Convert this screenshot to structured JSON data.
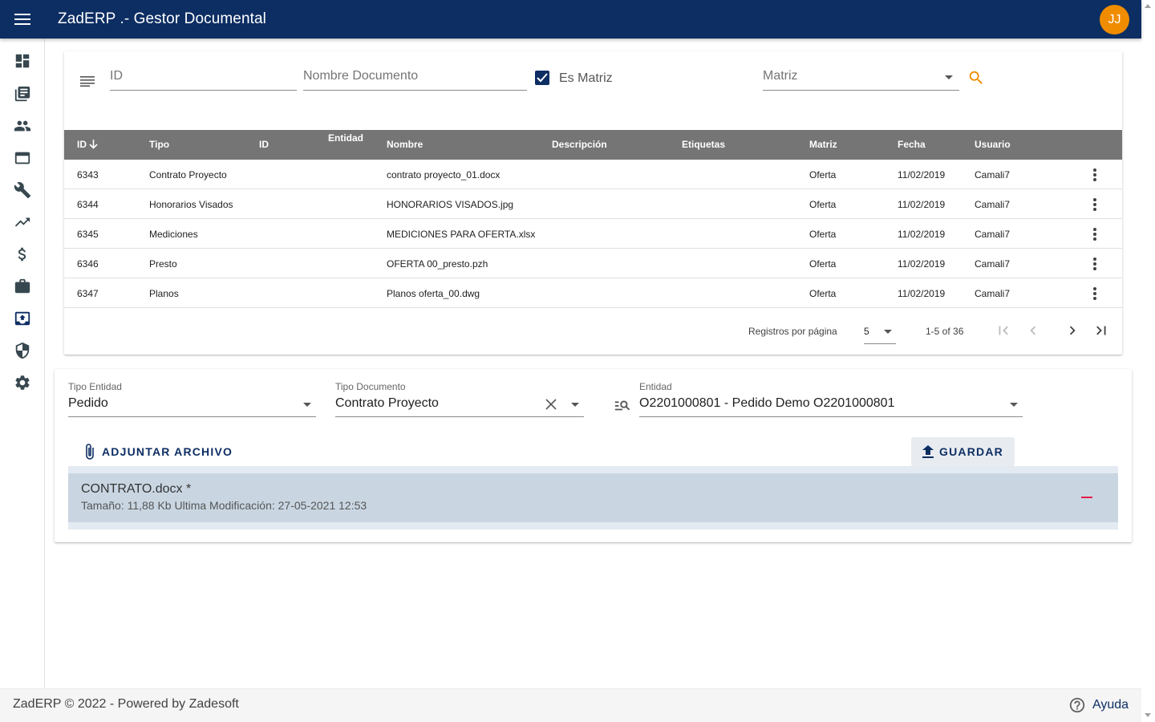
{
  "app": {
    "title": "ZadERP .- Gestor Documental",
    "user_initials": "JJ",
    "colors": {
      "primary": "#0d2e63",
      "avatar": "#f08c00",
      "accent_search": "#f08c00",
      "remove": "#e8194b"
    }
  },
  "sidenav": {
    "items": [
      {
        "icon": "dashboard-icon"
      },
      {
        "icon": "library-books-icon"
      },
      {
        "icon": "people-icon"
      },
      {
        "icon": "web-window-icon"
      },
      {
        "icon": "wrench-icon"
      },
      {
        "icon": "trending-up-icon"
      },
      {
        "icon": "dollar-icon"
      },
      {
        "icon": "briefcase-icon"
      },
      {
        "icon": "upload-archive-icon"
      },
      {
        "icon": "shield-icon"
      },
      {
        "icon": "gear-icon"
      }
    ]
  },
  "filters": {
    "id_placeholder": "ID",
    "nombre_placeholder": "Nombre Documento",
    "es_matriz_label": "Es Matriz",
    "es_matriz_checked": true,
    "matriz_placeholder": "Matriz"
  },
  "table": {
    "headers": {
      "id": "ID",
      "tipo": "Tipo",
      "id2": "ID",
      "entidad": "Entidad",
      "nombre": "Nombre",
      "descripcion": "Descripción",
      "etiquetas": "Etiquetas",
      "matriz": "Matriz",
      "fecha": "Fecha",
      "usuario": "Usuario"
    },
    "rows": [
      {
        "id": "6343",
        "tipo": "Contrato Proyecto",
        "nombre": "contrato proyecto_01.docx",
        "matriz": "Oferta",
        "fecha": "11/02/2019",
        "usuario": "Camali7"
      },
      {
        "id": "6344",
        "tipo": "Honorarios Visados",
        "nombre": "HONORARIOS VISADOS.jpg",
        "matriz": "Oferta",
        "fecha": "11/02/2019",
        "usuario": "Camali7"
      },
      {
        "id": "6345",
        "tipo": "Mediciones",
        "nombre": "MEDICIONES PARA OFERTA.xlsx",
        "matriz": "Oferta",
        "fecha": "11/02/2019",
        "usuario": "Camali7"
      },
      {
        "id": "6346",
        "tipo": "Presto",
        "nombre": "OFERTA 00_presto.pzh",
        "matriz": "Oferta",
        "fecha": "11/02/2019",
        "usuario": "Camali7"
      },
      {
        "id": "6347",
        "tipo": "Planos",
        "nombre": "Planos oferta_00.dwg",
        "matriz": "Oferta",
        "fecha": "11/02/2019",
        "usuario": "Camali7"
      }
    ]
  },
  "paginator": {
    "label": "Registros por página",
    "page_size": "5",
    "range": "1-5 of 36"
  },
  "upload": {
    "tipo_entidad_label": "Tipo Entidad",
    "tipo_entidad_value": "Pedido",
    "tipo_documento_label": "Tipo Documento",
    "tipo_documento_value": "Contrato Proyecto",
    "entidad_label": "Entidad",
    "entidad_value": "O2201000801 - Pedido Demo O2201000801",
    "adjuntar_label": "ADJUNTAR ARCHIVO",
    "guardar_label": "GUARDAR",
    "file": {
      "name": "CONTRATO.docx *",
      "meta": "Tamaño: 11,88 Kb Ultima Modificación: 27-05-2021 12:53"
    }
  },
  "footer": {
    "text": "ZadERP © 2022 - Powered by Zadesoft",
    "help_label": "Ayuda"
  }
}
